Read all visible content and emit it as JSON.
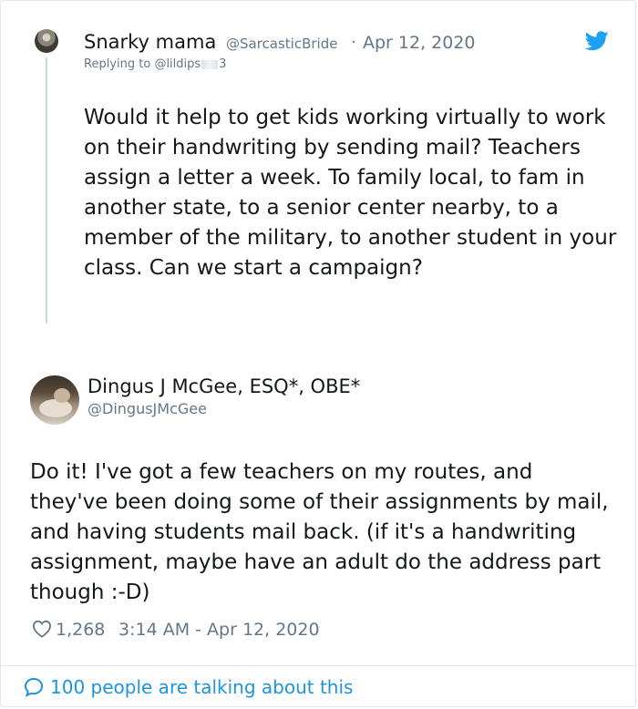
{
  "colors": {
    "text": "#14171a",
    "muted": "#657786",
    "link_blue": "#1b95e0",
    "twitter_blue": "#1da1f2",
    "border": "#e1e8ed"
  },
  "parent_tweet": {
    "author_name": "Snarky mama",
    "handle": "@SarcasticBride",
    "separator": "·",
    "date": "Apr 12, 2020",
    "replying_to_prefix": "Replying to ",
    "replying_to_handle_start": "@lildips",
    "replying_to_handle_end": "3",
    "text": "Would it help to get kids working virtually to work on their handwriting by sending mail? Teachers assign a letter a week. To family local, to fam in another state, to a senior center nearby, to a member of the military, to another student in your class. Can we start a campaign?",
    "icons": [
      "avatar",
      "twitter-bird-icon"
    ]
  },
  "reply_tweet": {
    "author_name": "Dingus J McGee, ESQ*, OBE*",
    "handle": "@DingusJMcGee",
    "text": "Do it! I've got a few teachers on my routes, and they've been doing some of their assignments by mail, and having students mail back. (if it's a handwriting assignment, maybe have an adult do the address part though :-D)",
    "like_count": "1,268",
    "timestamp": "3:14 AM - Apr 12, 2020",
    "icons": [
      "heart-icon"
    ]
  },
  "footer": {
    "talking_text": "100 people are talking about this",
    "icon": "speech-bubble-icon"
  }
}
